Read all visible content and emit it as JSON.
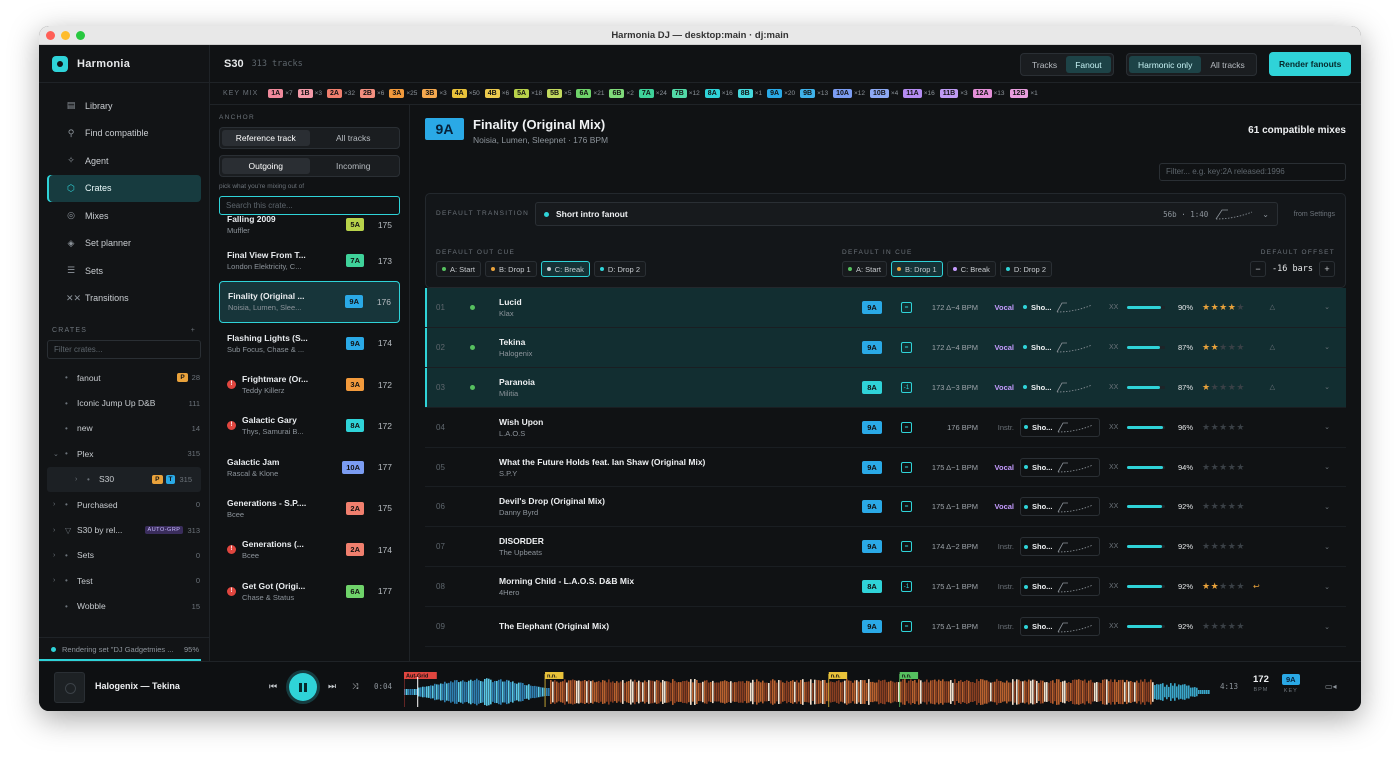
{
  "window": {
    "title": "Harmonia DJ — desktop:main · dj:main"
  },
  "brand": {
    "name": "Harmonia"
  },
  "nav": [
    {
      "label": "Library",
      "icon": "library-icon",
      "glyph": "▤",
      "active": false
    },
    {
      "label": "Find compatible",
      "icon": "search-icon",
      "glyph": "⚲",
      "active": false
    },
    {
      "label": "Agent",
      "icon": "agent-icon",
      "glyph": "✧",
      "active": false
    },
    {
      "label": "Crates",
      "icon": "crate-icon",
      "glyph": "⬡",
      "active": true
    },
    {
      "label": "Mixes",
      "icon": "mixes-icon",
      "glyph": "◎",
      "active": false
    },
    {
      "label": "Set planner",
      "icon": "set-planner-icon",
      "glyph": "◈",
      "active": false
    },
    {
      "label": "Sets",
      "icon": "sets-icon",
      "glyph": "☰",
      "active": false
    },
    {
      "label": "Transitions",
      "icon": "transitions-icon",
      "glyph": "✕✕",
      "active": false
    }
  ],
  "crates": {
    "heading": "CRATES",
    "add": "+",
    "filter_placeholder": "Filter crates...",
    "items": [
      {
        "name": "fanout",
        "count": "28",
        "chev": "",
        "bullet": "•",
        "badges": [
          {
            "t": "P",
            "c": "#e9a23b"
          }
        ]
      },
      {
        "name": "Iconic Jump Up D&B",
        "count": "111",
        "chev": "",
        "bullet": "•",
        "badges": []
      },
      {
        "name": "new",
        "count": "14",
        "chev": "",
        "bullet": "•",
        "badges": []
      },
      {
        "name": "Plex",
        "count": "315",
        "chev": "⌄",
        "bullet": "•",
        "badges": []
      },
      {
        "name": "S30",
        "count": "315",
        "chev": "›",
        "bullet": "•",
        "badges": [
          {
            "t": "P",
            "c": "#e9a23b"
          },
          {
            "t": "T",
            "c": "#2aa9e6"
          }
        ],
        "selected": true
      },
      {
        "name": "Purchased",
        "count": "0",
        "chev": "›",
        "bullet": "•",
        "badges": []
      },
      {
        "name": "S30 by rel...",
        "count": "313",
        "chev": "›",
        "bullet": "▽",
        "badges": [],
        "tag": "AUTO-GRP"
      },
      {
        "name": "Sets",
        "count": "0",
        "chev": "›",
        "bullet": "•",
        "badges": []
      },
      {
        "name": "Test",
        "count": "0",
        "chev": "›",
        "bullet": "•",
        "badges": []
      },
      {
        "name": "Wobble",
        "count": "15",
        "chev": "",
        "bullet": "•",
        "badges": []
      }
    ]
  },
  "render_status": {
    "text": "Rendering set \"DJ Gadgetmies ...",
    "pct": "95%"
  },
  "topbar": {
    "crate": "S30",
    "count": "313 tracks",
    "view_tabs": [
      {
        "label": "Tracks",
        "on": false
      },
      {
        "label": "Fanout",
        "on": true
      }
    ],
    "filter_tabs": [
      {
        "label": "Harmonic only",
        "on": true
      },
      {
        "label": "All tracks",
        "on": false
      }
    ],
    "render_button": "Render fanouts"
  },
  "keymix": {
    "label": "KEY MIX",
    "items": [
      {
        "k": "1A",
        "c": "×7",
        "col": "#f08a9c"
      },
      {
        "k": "1B",
        "c": "×3",
        "col": "#f39aa8"
      },
      {
        "k": "2A",
        "c": "×32",
        "col": "#f07f6e"
      },
      {
        "k": "2B",
        "c": "×6",
        "col": "#f38f80"
      },
      {
        "k": "3A",
        "c": "×25",
        "col": "#f29a3c"
      },
      {
        "k": "3B",
        "c": "×3",
        "col": "#f5a94f"
      },
      {
        "k": "4A",
        "c": "×50",
        "col": "#e8c23a"
      },
      {
        "k": "4B",
        "c": "×6",
        "col": "#ecca4e"
      },
      {
        "k": "5A",
        "c": "×18",
        "col": "#b8d24a"
      },
      {
        "k": "5B",
        "c": "×5",
        "col": "#c2d95e"
      },
      {
        "k": "6A",
        "c": "×21",
        "col": "#6fd36a"
      },
      {
        "k": "6B",
        "c": "×2",
        "col": "#7fda7a"
      },
      {
        "k": "7A",
        "c": "×24",
        "col": "#3fd29a"
      },
      {
        "k": "7B",
        "c": "×12",
        "col": "#52d9a7"
      },
      {
        "k": "8A",
        "c": "×16",
        "col": "#2fd3d8"
      },
      {
        "k": "8B",
        "c": "×1",
        "col": "#45d8dc"
      },
      {
        "k": "9A",
        "c": "×20",
        "col": "#2aa9e6"
      },
      {
        "k": "9B",
        "c": "×13",
        "col": "#3fb2ea"
      },
      {
        "k": "10A",
        "c": "×12",
        "col": "#7b9cf2"
      },
      {
        "k": "10B",
        "c": "×4",
        "col": "#8da9f4"
      },
      {
        "k": "11A",
        "c": "×16",
        "col": "#b58cf2"
      },
      {
        "k": "11B",
        "c": "×3",
        "col": "#bf9bf4"
      },
      {
        "k": "12A",
        "c": "×13",
        "col": "#e48fd8"
      },
      {
        "k": "12B",
        "c": "×1",
        "col": "#e99edf"
      }
    ]
  },
  "anchor": {
    "heading": "ANCHOR",
    "mode": [
      {
        "label": "Reference track",
        "on": true
      },
      {
        "label": "All tracks",
        "on": false
      }
    ],
    "direction": [
      {
        "label": "Outgoing",
        "on": true
      },
      {
        "label": "Incoming",
        "on": false
      }
    ],
    "hint": "pick what you're mixing out of",
    "search_placeholder": "Search this crate...",
    "tracks": [
      {
        "title": "Falling 2009",
        "artist": "Muffler",
        "key": "5A",
        "bpm": "175",
        "col": "#b8d24a",
        "warn": false,
        "cut": true
      },
      {
        "title": "Final View From T...",
        "artist": "London Elektricity, C...",
        "key": "7A",
        "bpm": "173",
        "col": "#3fd29a",
        "warn": false
      },
      {
        "title": "Finality (Original ...",
        "artist": "Noisia, Lumen, Slee...",
        "key": "9A",
        "bpm": "176",
        "col": "#2aa9e6",
        "warn": false,
        "selected": true
      },
      {
        "title": "Flashing Lights (S...",
        "artist": "Sub Focus, Chase & ...",
        "key": "9A",
        "bpm": "174",
        "col": "#2aa9e6",
        "warn": false
      },
      {
        "title": "Frightmare (Or...",
        "artist": "Teddy Killerz",
        "key": "3A",
        "bpm": "172",
        "col": "#f29a3c",
        "warn": true
      },
      {
        "title": "Galactic Gary",
        "artist": "Thys, Samurai B...",
        "key": "8A",
        "bpm": "172",
        "col": "#2fd3d8",
        "warn": true
      },
      {
        "title": "Galactic Jam",
        "artist": "Rascal & Klone",
        "key": "10A",
        "bpm": "177",
        "col": "#7b9cf2",
        "warn": false
      },
      {
        "title": "Generations - S.P....",
        "artist": "Bcee",
        "key": "2A",
        "bpm": "175",
        "col": "#f07f6e",
        "warn": false
      },
      {
        "title": "Generations (...",
        "artist": "Bcee",
        "key": "2A",
        "bpm": "174",
        "col": "#f07f6e",
        "warn": true
      },
      {
        "title": "Get Got (Origi...",
        "artist": "Chase & Status",
        "key": "6A",
        "bpm": "177",
        "col": "#6fd36a",
        "warn": true
      }
    ]
  },
  "detail": {
    "key": "9A",
    "title": "Finality (Original Mix)",
    "subtitle": "Noisia, Lumen, Sleepnet · 176 BPM",
    "compat": "61 compatible mixes",
    "filter_placeholder": "Filter... e.g. key:2A released:1996",
    "default_transition": {
      "label": "DEFAULT TRANSITION",
      "name": "Short intro fanout",
      "meta": "56b · 1:40",
      "from": "from Settings"
    },
    "out_cue": {
      "label": "DEFAULT OUT CUE",
      "items": [
        {
          "t": "A: Start",
          "col": "#56c05f",
          "on": false
        },
        {
          "t": "B: Drop 1",
          "col": "#e9a23b",
          "on": false
        },
        {
          "t": "C: Break",
          "col": "#c7cbcf",
          "on": true
        },
        {
          "t": "D: Drop 2",
          "col": "#2fd3d8",
          "on": false
        }
      ]
    },
    "in_cue": {
      "label": "DEFAULT IN CUE",
      "items": [
        {
          "t": "A: Start",
          "col": "#56c05f",
          "on": false
        },
        {
          "t": "B: Drop 1",
          "col": "#e9a23b",
          "on": true
        },
        {
          "t": "C: Break",
          "col": "#c59bff",
          "on": false
        },
        {
          "t": "D: Drop 2",
          "col": "#2fd3d8",
          "on": false
        }
      ]
    },
    "offset": {
      "label": "DEFAULT OFFSET",
      "minus": "−",
      "value": "-16 bars",
      "plus": "+"
    },
    "rows": [
      {
        "n": "01",
        "title": "Lucid",
        "artist": "Klax",
        "key": "9A",
        "col": "#2aa9e6",
        "rel": "=",
        "bpm": "172 Δ−4 BPM",
        "voc": "Vocal",
        "tr": "Sho...",
        "pct": 90,
        "stars": 4,
        "hl": true,
        "tri": "△",
        "ret": ""
      },
      {
        "n": "02",
        "title": "Tekina",
        "artist": "Halogenix",
        "key": "9A",
        "col": "#2aa9e6",
        "rel": "=",
        "bpm": "172 Δ−4 BPM",
        "voc": "Vocal",
        "tr": "Sho...",
        "pct": 87,
        "stars": 2,
        "hl": true,
        "tri": "△",
        "ret": ""
      },
      {
        "n": "03",
        "title": "Paranoia",
        "artist": "Militia",
        "key": "8A",
        "col": "#2fd3d8",
        "rel": "-1",
        "bpm": "173 Δ−3 BPM",
        "voc": "Vocal",
        "tr": "Sho...",
        "pct": 87,
        "stars": 1,
        "hl": true,
        "tri": "△",
        "ret": ""
      },
      {
        "n": "04",
        "title": "Wish Upon",
        "artist": "L.A.O.S",
        "key": "9A",
        "col": "#2aa9e6",
        "rel": "=",
        "bpm": "176 BPM",
        "voc": "Instr.",
        "tr": "Sho...",
        "pct": 96,
        "stars": 0,
        "hl": false,
        "tri": "",
        "ret": ""
      },
      {
        "n": "05",
        "title": "What the Future Holds feat. Ian Shaw (Original Mix)",
        "artist": "S.P.Y",
        "key": "9A",
        "col": "#2aa9e6",
        "rel": "=",
        "bpm": "175 Δ−1 BPM",
        "voc": "Vocal",
        "tr": "Sho...",
        "pct": 94,
        "stars": 0,
        "hl": false,
        "tri": "",
        "ret": ""
      },
      {
        "n": "06",
        "title": "Devil's Drop (Original Mix)",
        "artist": "Danny Byrd",
        "key": "9A",
        "col": "#2aa9e6",
        "rel": "=",
        "bpm": "175 Δ−1 BPM",
        "voc": "Vocal",
        "tr": "Sho...",
        "pct": 92,
        "stars": 0,
        "hl": false,
        "tri": "",
        "ret": ""
      },
      {
        "n": "07",
        "title": "DISORDER",
        "artist": "The Upbeats",
        "key": "9A",
        "col": "#2aa9e6",
        "rel": "=",
        "bpm": "174 Δ−2 BPM",
        "voc": "Instr.",
        "tr": "Sho...",
        "pct": 92,
        "stars": 0,
        "hl": false,
        "tri": "",
        "ret": ""
      },
      {
        "n": "08",
        "title": "Morning Child - L.A.O.S. D&B Mix",
        "artist": "4Hero",
        "key": "8A",
        "col": "#2fd3d8",
        "rel": "-1",
        "bpm": "175 Δ−1 BPM",
        "voc": "Instr.",
        "tr": "Sho...",
        "pct": 92,
        "stars": 2,
        "hl": false,
        "tri": "",
        "ret": "↩"
      },
      {
        "n": "09",
        "title": "The Elephant (Original Mix)",
        "artist": "",
        "key": "9A",
        "col": "#2aa9e6",
        "rel": "=",
        "bpm": "175 Δ−1 BPM",
        "voc": "Instr.",
        "tr": "Sho...",
        "pct": 92,
        "stars": 0,
        "hl": false,
        "tri": "",
        "ret": ""
      }
    ],
    "xx": "XX"
  },
  "player": {
    "now_playing": "Halogenix — Tekina",
    "elapsed": "0:04",
    "duration": "4:13",
    "bpm": "172",
    "bpm_label": "BPM",
    "key": "9A",
    "key_label": "KEY",
    "markers": [
      {
        "t": "Aut-Grid",
        "pos": 0.0,
        "col": "#e0463f"
      },
      {
        "t": "n.n.",
        "pos": 0.175,
        "col": "#e9c23a"
      },
      {
        "t": "n.n.",
        "pos": 0.527,
        "col": "#e9c23a"
      },
      {
        "t": "n.n.",
        "pos": 0.615,
        "col": "#56c05f"
      }
    ],
    "progress": 0.017
  }
}
